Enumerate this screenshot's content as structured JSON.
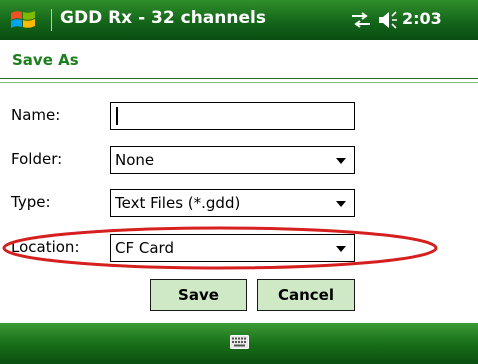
{
  "statusbar": {
    "title": "GDD Rx - 32 channels",
    "time": "2:03",
    "icons": [
      "windows-start-icon",
      "connectivity-icon",
      "volume-icon"
    ]
  },
  "dialog": {
    "heading": "Save As",
    "fields": {
      "name": {
        "label": "Name:",
        "value": ""
      },
      "folder": {
        "label": "Folder:",
        "value": "None"
      },
      "type": {
        "label": "Type:",
        "value": "Text Files (*.gdd)"
      },
      "location": {
        "label": "Location:",
        "value": "CF Card"
      }
    },
    "buttons": {
      "save": "Save",
      "cancel": "Cancel"
    }
  },
  "menubar": {
    "icon": "keyboard-icon"
  },
  "colors": {
    "bar_green": "#14661a",
    "heading_green": "#1b7f1c",
    "button_fill": "#cfe9c6",
    "annotation_red": "#d61f1f"
  }
}
